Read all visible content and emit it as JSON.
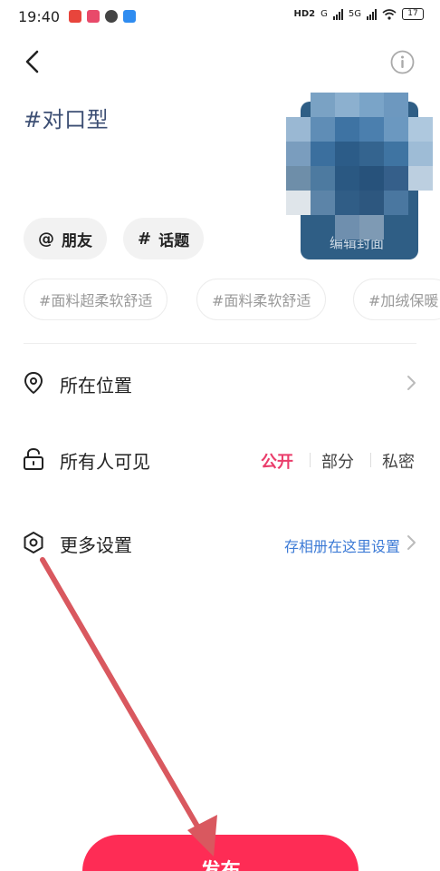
{
  "status_bar": {
    "time": "19:40",
    "network": "HD2",
    "signal_a": "G",
    "signal_b": "5G",
    "battery": "17"
  },
  "header": {
    "back_icon": "chevron-left-icon",
    "info_icon": "info-circle-icon"
  },
  "topic_title": "#对口型",
  "cover": {
    "label": "编辑封面"
  },
  "chips": {
    "friends": {
      "symbol": "@",
      "label": "朋友"
    },
    "topic": {
      "symbol": "#",
      "label": "话题"
    }
  },
  "suggested_tags": [
    "#面料超柔软舒适",
    "#面料柔软舒适",
    "#加绒保暖"
  ],
  "settings": {
    "location": {
      "label": "所在位置",
      "icon": "location-pin-icon"
    },
    "visibility": {
      "label": "所有人可见",
      "icon": "lock-icon",
      "options": [
        "公开",
        "部分",
        "私密"
      ],
      "selected": "公开"
    },
    "more": {
      "label": "更多设置",
      "icon": "hexagon-settings-icon",
      "hint": "存相册在这里设置"
    }
  },
  "publish_button": "发布",
  "colors": {
    "accent": "#fe2c55",
    "active_option": "#ea3d6b",
    "link": "#3d7bd6",
    "topic_title": "#3d4f74",
    "annotation_arrow": "#d9585f"
  }
}
